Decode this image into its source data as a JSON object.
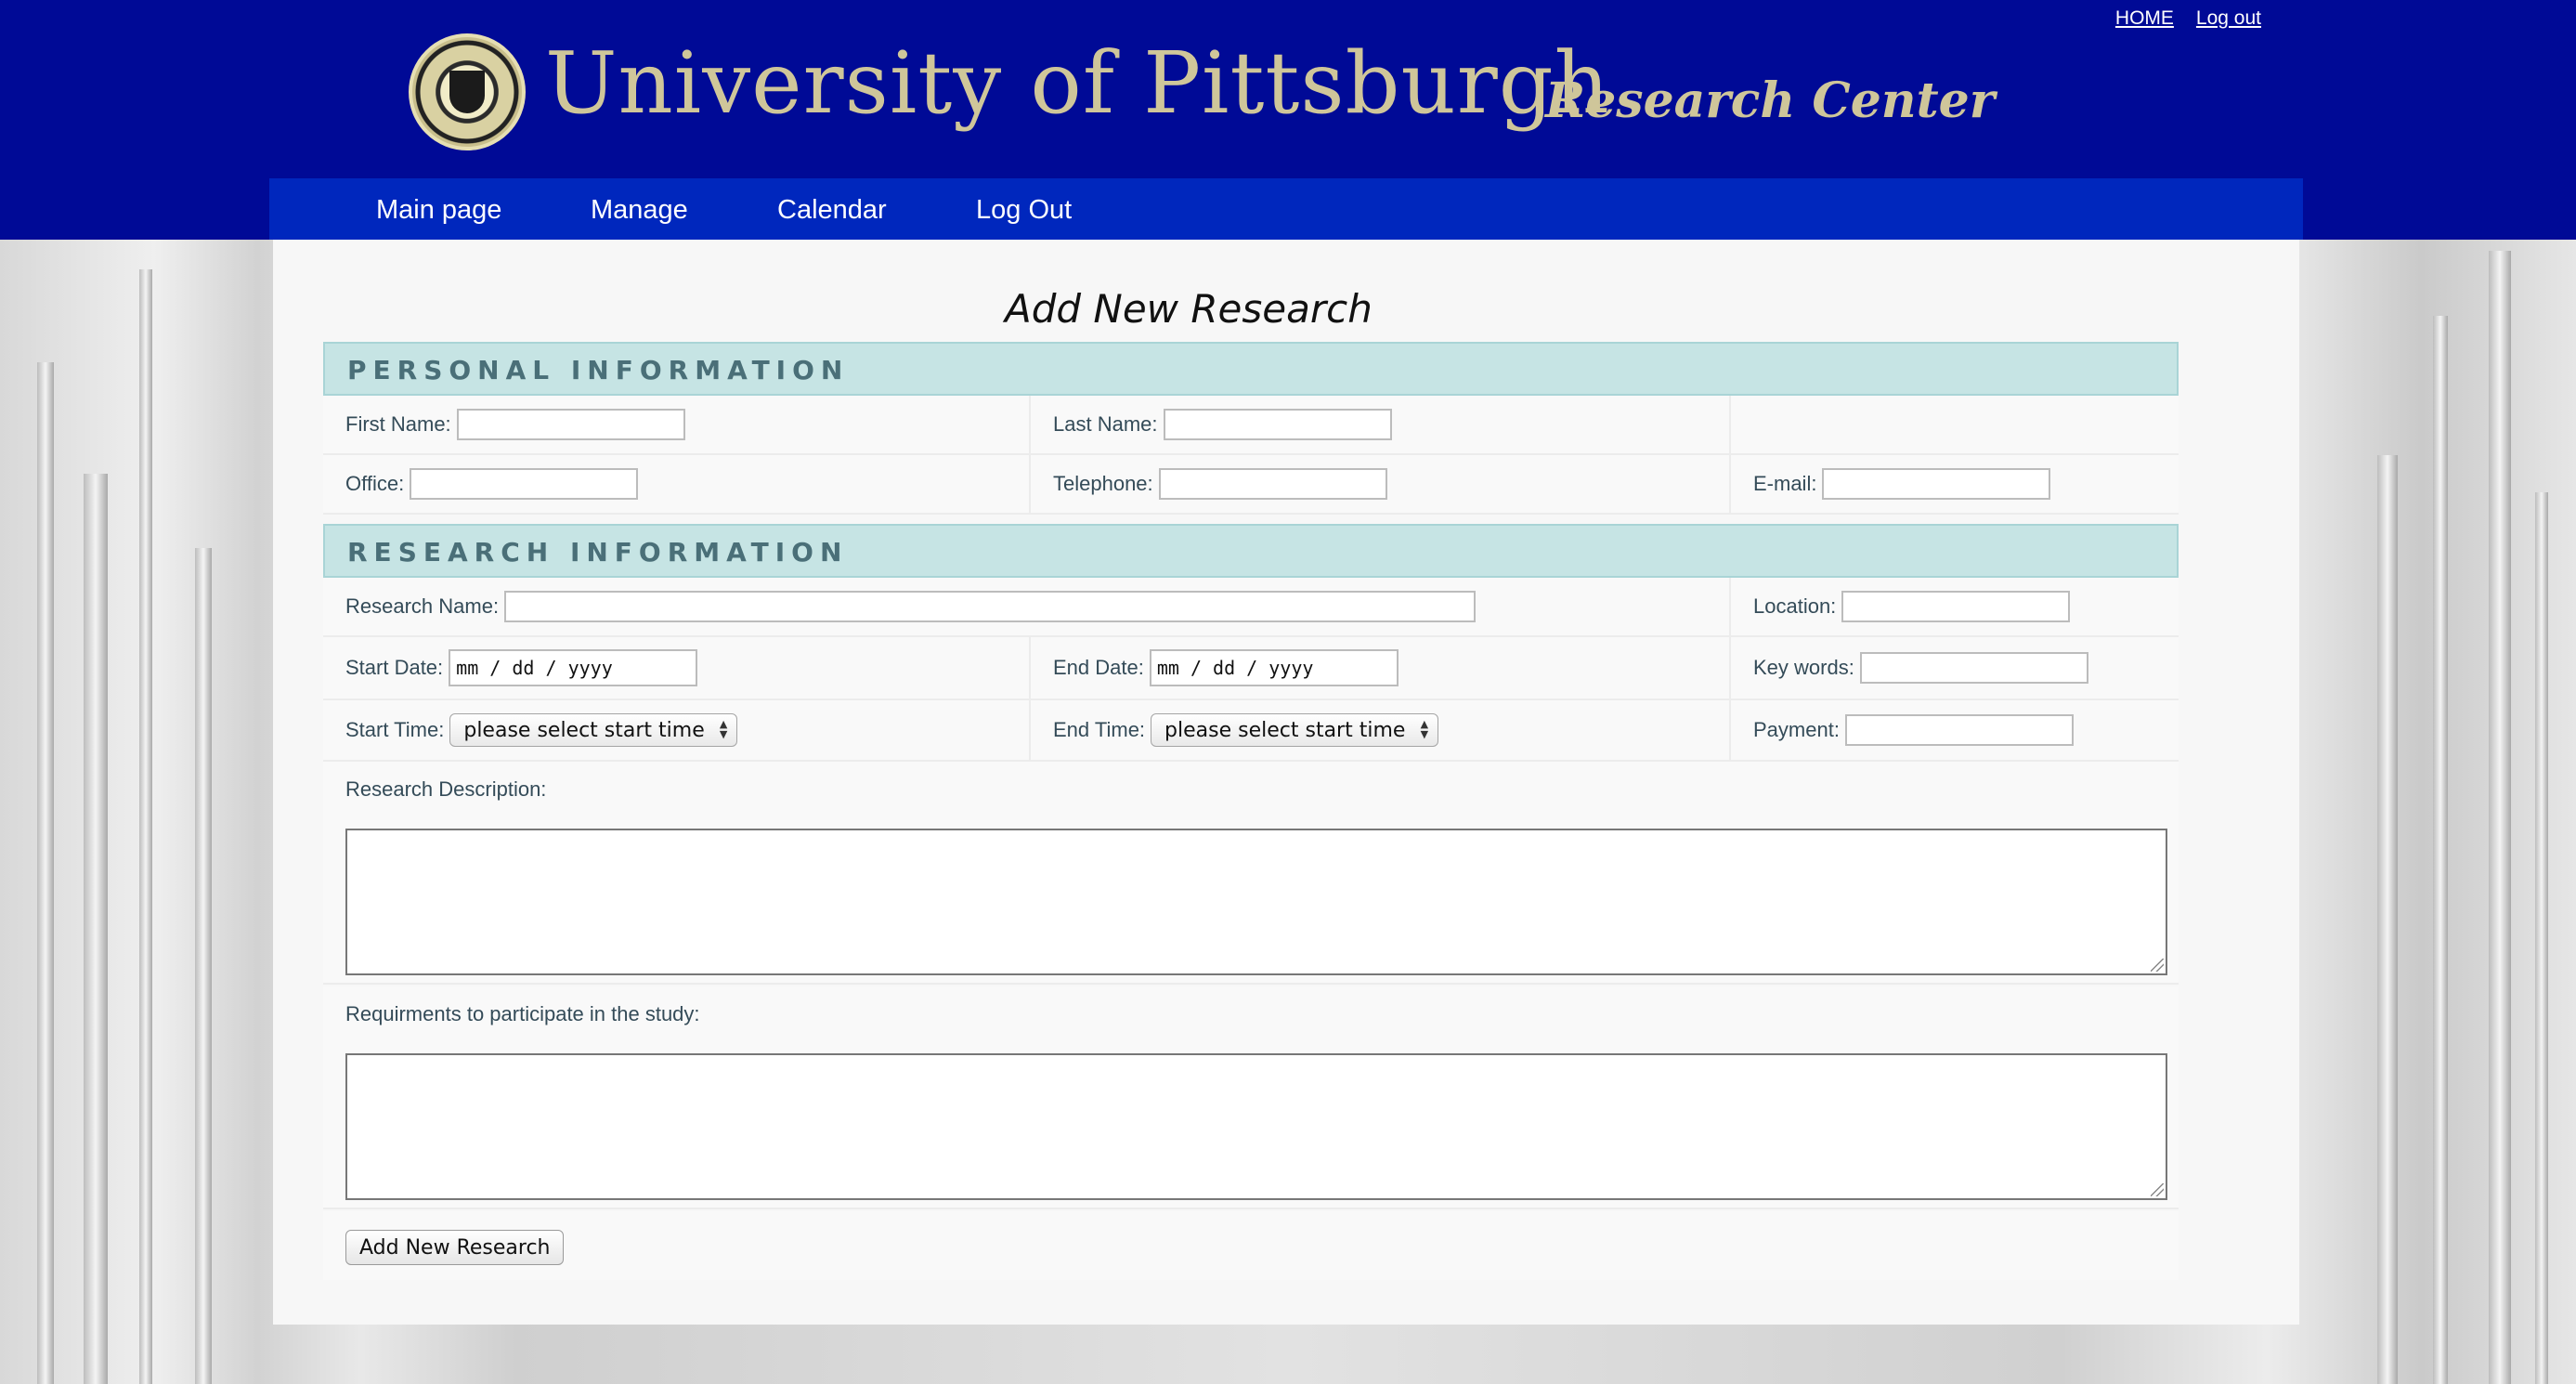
{
  "top_links": {
    "home": "HOME",
    "logout": "Log out"
  },
  "brand": {
    "university": "University of Pittsburgh",
    "center": "Research Center"
  },
  "nav": {
    "items": [
      "Main page",
      "Manage",
      "Calendar",
      "Log Out"
    ]
  },
  "form": {
    "title": "Add New Research",
    "personal_section": "PERSONAL INFORMATION",
    "research_section": "RESEARCH INFORMATION",
    "labels": {
      "first_name": "First Name:",
      "last_name": "Last Name:",
      "office": "Office:",
      "telephone": "Telephone:",
      "email": "E-mail:",
      "research_name": "Research Name:",
      "location": "Location:",
      "start_date": "Start Date:",
      "end_date": "End Date:",
      "key_words": "Key words:",
      "start_time": "Start Time:",
      "end_time": "End Time:",
      "payment": "Payment:",
      "description": "Research Description:",
      "requirements": "Requirments to participate in the study:"
    },
    "date_placeholder": "mm / dd / yyyy",
    "start_time_value": "please select start time",
    "end_time_value": "please select start time",
    "submit_label": "Add New Research"
  },
  "colors": {
    "header_bg": "#000a96",
    "nav_bg": "#0027bd",
    "section_bg": "#c6e4e4",
    "brand_gold": "#cfc69a"
  }
}
